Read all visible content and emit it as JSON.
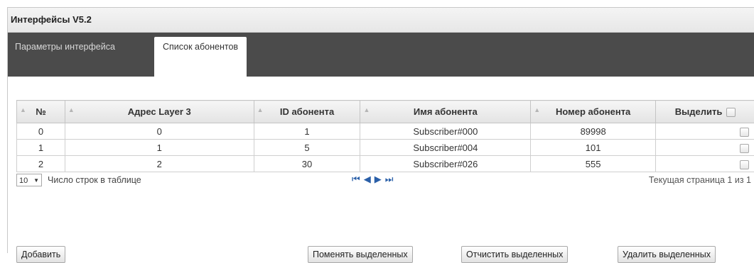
{
  "window": {
    "title": "Интерфейсы V5.2"
  },
  "tabs": [
    {
      "label": "Параметры интерфейса",
      "active": false
    },
    {
      "label": "Список абонентов",
      "active": true
    }
  ],
  "table": {
    "headers": [
      "№",
      "Адрес Layer 3",
      "ID абонента",
      "Имя абонента",
      "Номер абонента",
      "Выделить"
    ],
    "rows": [
      {
        "num": "0",
        "l3": "0",
        "id": "1",
        "name": "Subscriber#000",
        "phone": "89998",
        "checked": false
      },
      {
        "num": "1",
        "l3": "1",
        "id": "5",
        "name": "Subscriber#004",
        "phone": "101",
        "checked": false
      },
      {
        "num": "2",
        "l3": "2",
        "id": "30",
        "name": "Subscriber#026",
        "phone": "555",
        "checked": false
      }
    ]
  },
  "pager": {
    "rows_per_page": "10",
    "rows_label": "Число строк в таблице",
    "first_icon": "first-page-icon",
    "prev_icon": "prev-page-icon",
    "next_icon": "next-page-icon",
    "last_icon": "last-page-icon",
    "page_info": "Текущая страница 1 из 1"
  },
  "buttons": {
    "add": "Добавить",
    "change": "Поменять выделенных",
    "clear": "Отчистить выделенных",
    "delete": "Удалить выделенных"
  },
  "colors": {
    "tabbar": "#4b4b4b",
    "nav_accent": "#2a5fa8"
  }
}
